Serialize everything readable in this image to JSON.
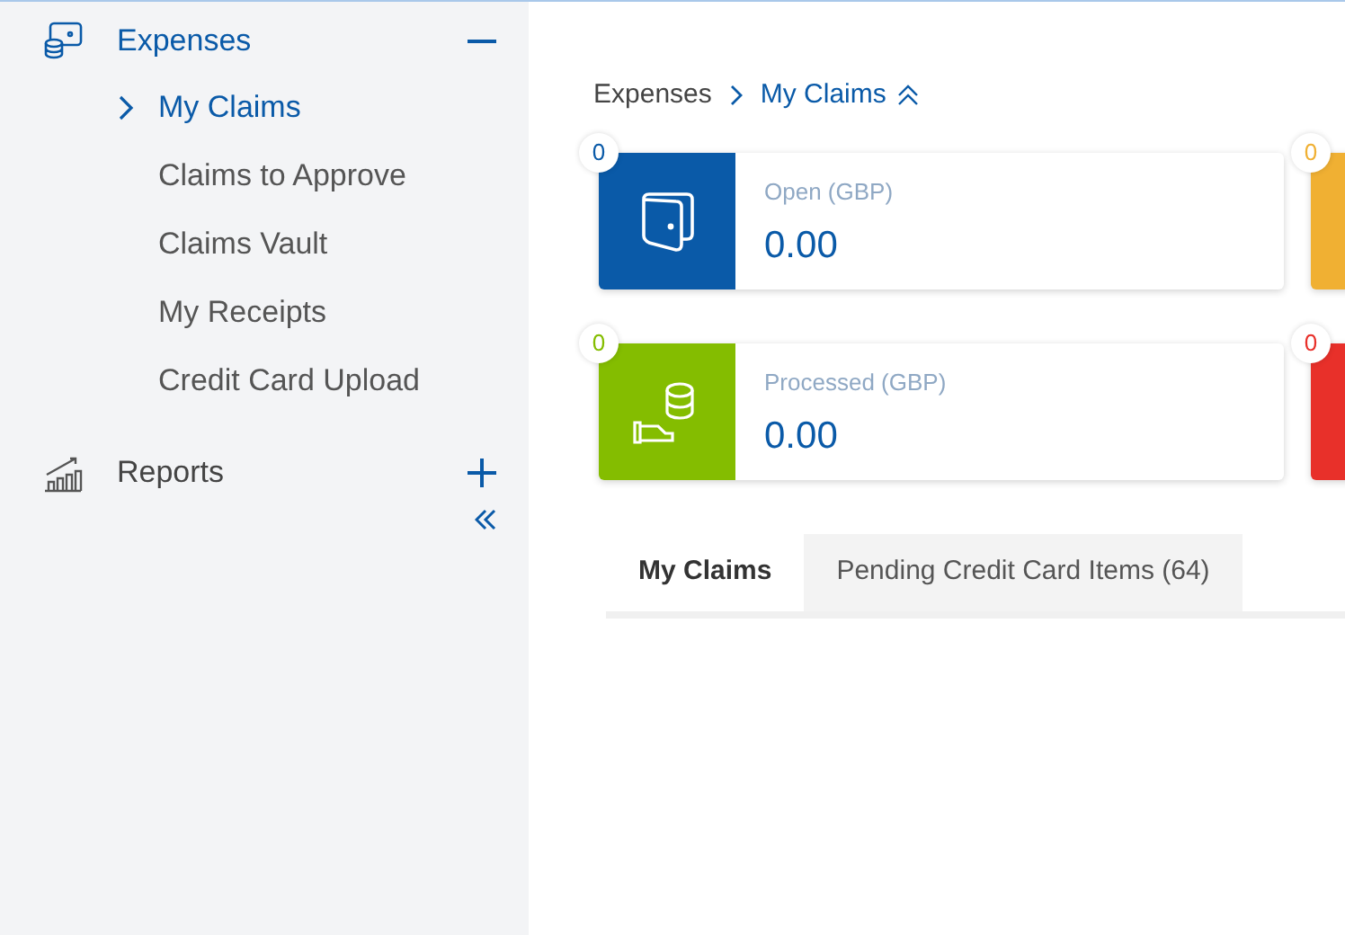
{
  "sidebar": {
    "sections": [
      {
        "label": "Expenses",
        "kind": "money",
        "expanded": true,
        "selected": true,
        "children": [
          {
            "label": "My Claims",
            "selected": true
          },
          {
            "label": "Claims to Approve",
            "selected": false
          },
          {
            "label": "Claims Vault",
            "selected": false
          },
          {
            "label": "My Receipts",
            "selected": false
          },
          {
            "label": "Credit Card Upload",
            "selected": false
          }
        ]
      },
      {
        "label": "Reports",
        "kind": "chart",
        "expanded": false,
        "selected": false
      }
    ]
  },
  "breadcrumb": [
    "Expenses",
    "My Claims"
  ],
  "cards": [
    {
      "kind": "wallet",
      "color": "#0a5aa8",
      "badge": "0",
      "label": "Open (GBP)",
      "value": "0.00"
    },
    {
      "kind": "partial",
      "color": "#f0b033",
      "badge": "0"
    },
    {
      "kind": "coins",
      "color": "#84bd00",
      "badge": "0",
      "label": "Processed (GBP)",
      "value": "0.00"
    },
    {
      "kind": "partial",
      "color": "#e8302a",
      "badge": "0"
    }
  ],
  "tabs": [
    {
      "label": "My Claims",
      "selected": true
    },
    {
      "label": "Pending Credit Card Items (64)",
      "selected": false
    }
  ]
}
